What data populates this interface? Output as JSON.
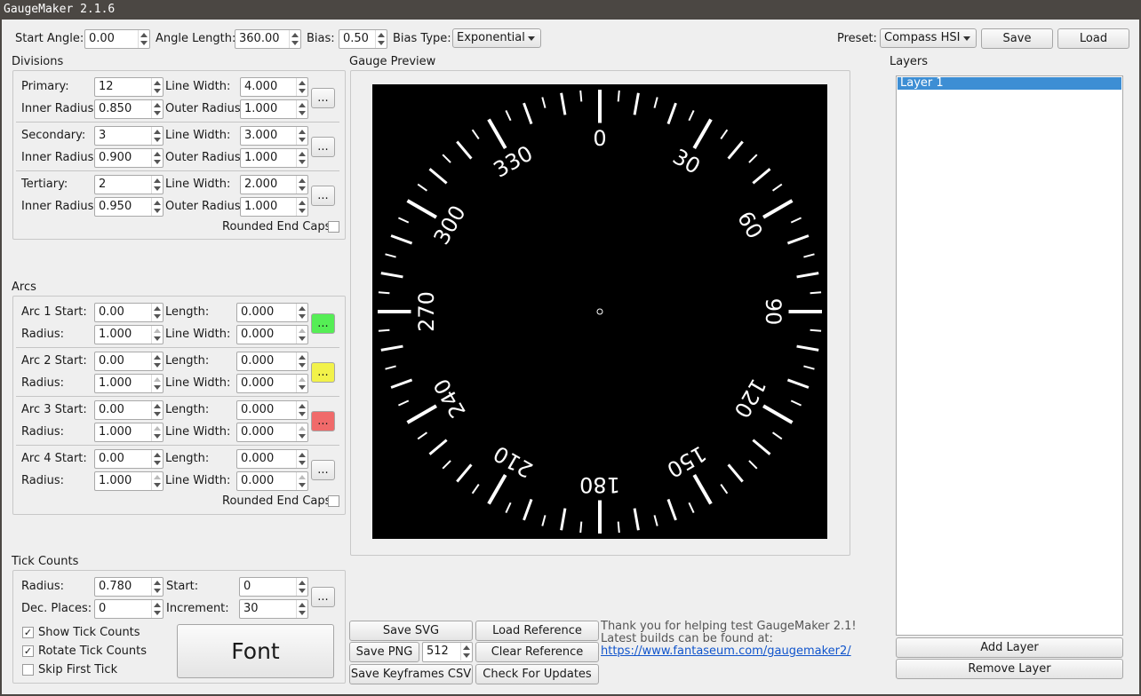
{
  "window": {
    "title": "GaugeMaker 2.1.6"
  },
  "toolbar": {
    "start_angle_label": "Start Angle:",
    "start_angle": "0.00",
    "angle_length_label": "Angle Length:",
    "angle_length": "360.00",
    "bias_label": "Bias:",
    "bias": "0.50",
    "bias_type_label": "Bias Type:",
    "bias_type": "Exponential",
    "preset_label": "Preset:",
    "preset": "Compass HSI",
    "save_label": "Save",
    "load_label": "Load"
  },
  "divisions": {
    "title": "Divisions",
    "rows": [
      {
        "name_label": "Primary:",
        "count": "12",
        "line_width": "4.000",
        "inner_radius": "0.850",
        "outer_radius": "1.000"
      },
      {
        "name_label": "Secondary:",
        "count": "3",
        "line_width": "3.000",
        "inner_radius": "0.900",
        "outer_radius": "1.000"
      },
      {
        "name_label": "Tertiary:",
        "count": "2",
        "line_width": "2.000",
        "inner_radius": "0.950",
        "outer_radius": "1.000"
      }
    ],
    "line_width_label": "Line Width:",
    "inner_radius_label": "Inner Radius:",
    "outer_radius_label": "Outer Radius:",
    "more_label": "...",
    "rounded_caps_label": "Rounded End Caps"
  },
  "arcs": {
    "title": "Arcs",
    "rows": [
      {
        "start_label": "Arc 1 Start:",
        "start": "0.00",
        "length": "0.000",
        "radius": "1.000",
        "line_width": "0.000",
        "color": "#55ee55"
      },
      {
        "start_label": "Arc 2 Start:",
        "start": "0.00",
        "length": "0.000",
        "radius": "1.000",
        "line_width": "0.000",
        "color": "#f2f24a"
      },
      {
        "start_label": "Arc 3 Start:",
        "start": "0.00",
        "length": "0.000",
        "radius": "1.000",
        "line_width": "0.000",
        "color": "#f06a6a"
      },
      {
        "start_label": "Arc 4 Start:",
        "start": "0.00",
        "length": "0.000",
        "radius": "1.000",
        "line_width": "0.000",
        "color": ""
      }
    ],
    "length_label": "Length:",
    "radius_label": "Radius:",
    "line_width_label": "Line Width:",
    "more_label": "...",
    "rounded_caps_label": "Rounded End Caps"
  },
  "tick_counts": {
    "title": "Tick Counts",
    "radius_label": "Radius:",
    "radius": "0.780",
    "start_label": "Start:",
    "start": "0",
    "dec_places_label": "Dec. Places:",
    "dec_places": "0",
    "increment_label": "Increment:",
    "increment": "30",
    "more_label": "...",
    "show_label": "Show Tick Counts",
    "rotate_label": "Rotate Tick Counts",
    "skip_label": "Skip First Tick",
    "check_mark": "✓",
    "font_label": "Font"
  },
  "preview": {
    "title": "Gauge Preview",
    "labels": [
      "0",
      "30",
      "60",
      "90",
      "120",
      "150",
      "180",
      "210",
      "240",
      "270",
      "300",
      "330"
    ]
  },
  "actions": {
    "save_svg": "Save SVG",
    "load_reference": "Load Reference",
    "save_png": "Save PNG",
    "png_size": "512",
    "clear_reference": "Clear Reference",
    "save_keyframes": "Save Keyframes CSV",
    "check_updates": "Check For Updates",
    "info_line1": "Thank you for helping test GaugeMaker 2.1!",
    "info_line2": "Latest builds can be found at:",
    "info_link": "https://www.fantaseum.com/gaugemaker2/"
  },
  "layers": {
    "title": "Layers",
    "items": [
      "Layer 1"
    ],
    "add_label": "Add Layer",
    "remove_label": "Remove Layer"
  }
}
